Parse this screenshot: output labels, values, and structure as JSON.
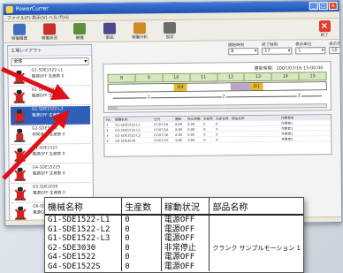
{
  "window": {
    "title": "PowerCurrer",
    "menu": "ファイル(F)  表示(V)  ヘルプ(H)"
  },
  "toolbar": {
    "items": [
      {
        "label": "稼働履歴",
        "icon": "history-icon",
        "color": "#3c6fc4"
      },
      {
        "label": "稼働状況",
        "icon": "robot-icon",
        "color": "#c9302a"
      },
      {
        "label": "機種",
        "icon": "machine-icon",
        "color": "#5a8f3c"
      },
      {
        "label": "部品",
        "icon": "parts-icon",
        "color": "#4a4a8c"
      },
      {
        "label": "稼働分析",
        "icon": "analysis-icon",
        "color": "#d08a25"
      },
      {
        "label": "設定",
        "icon": "settings-icon",
        "color": "#6b6b6b"
      }
    ],
    "exit_label": "終了"
  },
  "left_panel": {
    "header": "工場レイアウト",
    "select_value": "全体",
    "machines": [
      {
        "name": "G1-SDE1522-L1",
        "status": "電源OFF 生産数 0",
        "stopped": true,
        "selected": false
      },
      {
        "name": "G1-SDE1522-L2",
        "status": "電源OFF 生産数 0",
        "stopped": true,
        "selected": false
      },
      {
        "name": "G1-SDE1522-L3",
        "status": "電源OFF 生産数 0",
        "stopped": true,
        "selected": true
      },
      {
        "name": "G2-SDE3030",
        "status": "非常停止 生産数 0",
        "stopped": false,
        "selected": false
      },
      {
        "name": "G4-SDE1522",
        "status": "電源OFF 生産数 0",
        "stopped": true,
        "selected": false
      },
      {
        "name": "G4-SDE1522S",
        "status": "電源OFF 生産数 0",
        "stopped": true,
        "selected": false
      },
      {
        "name": "G5-SDE2030",
        "status": "電源OFF 生産数 0",
        "stopped": true,
        "selected": false
      },
      {
        "name": "G6-SDE1522",
        "status": "電源OFF 生産数 0",
        "stopped": true,
        "selected": false
      }
    ]
  },
  "filters": [
    {
      "label": "開始時刻",
      "value": "8"
    },
    {
      "label": "終了時刻",
      "value": "17"
    },
    {
      "label": "表示単位",
      "value": "1"
    },
    {
      "label": "表示件数",
      "value": "10"
    }
  ],
  "timeline": {
    "date_label": "更新時間：2007/07/16 15:00:00",
    "hours": [
      "8",
      "9",
      "10",
      "11",
      "12",
      "13",
      "14",
      "15"
    ],
    "segments": [
      {
        "label": "",
        "color": "#ffffff",
        "weight": 2.4
      },
      {
        "label": "D4",
        "color": "#e5b92c",
        "weight": 0.5
      },
      {
        "label": "",
        "color": "#ffffff",
        "weight": 1.6
      },
      {
        "label": "",
        "color": "#b9a7c9",
        "weight": 0.7
      },
      {
        "label": "D1",
        "color": "#e5b92c",
        "weight": 0.5
      },
      {
        "label": "",
        "color": "#ffffff",
        "weight": 2.3
      }
    ],
    "axis_marks": [
      "1",
      "2",
      "3"
    ]
  },
  "small_table": {
    "headers": [
      "No",
      "機種名称",
      "日付",
      "開始",
      "停止時間",
      "生産数",
      "生産台数",
      "部品名称",
      "作業者名"
    ],
    "rows": [
      [
        "1",
        "G1-SDE1522-L1",
        "07/07/16",
        "8:00",
        "0:00",
        "0",
        "0",
        "",
        "作業者1"
      ],
      [
        "2",
        "G1-SDE1522-L2",
        "07/07/16",
        "8:00",
        "0:00",
        "0",
        "0",
        "",
        "作業者1"
      ],
      [
        "3",
        "G1-SDE1522-L3",
        "07/07/16",
        "8:00",
        "0:00",
        "0",
        "0",
        "",
        "作業者1"
      ],
      [
        "4",
        "G2-SDE3030",
        "07/07/16",
        "9:00",
        "0:00",
        "0",
        "0",
        "",
        "作業者2"
      ]
    ]
  },
  "popup": {
    "headers": [
      "機械名称",
      "生産数",
      "稼動状況",
      "部品名称"
    ],
    "rows": [
      {
        "name": "G1-SDE1522-L1",
        "count": "0",
        "status": "電源OFF",
        "parts": ""
      },
      {
        "name": "G1-SDE1522-L2",
        "count": "0",
        "status": "電源OFF",
        "parts": ""
      },
      {
        "name": "G1-SDE1522-L3",
        "count": "0",
        "status": "電源OFF",
        "parts": ""
      },
      {
        "name": "G2-SDE3030",
        "count": "0",
        "status": "非常停止",
        "parts": "クランク サンプルモーション 1"
      },
      {
        "name": "G4-SDE1522",
        "count": "0",
        "status": "電源OFF",
        "parts": ""
      },
      {
        "name": "G4-SDE1522S",
        "count": "0",
        "status": "電源OFF",
        "parts": ""
      }
    ]
  },
  "colors": {
    "titlebar": "#2a5fc4",
    "selection": "#2f5fb8",
    "arrow": "#e0101a",
    "stopped_mark": "#e01818"
  }
}
